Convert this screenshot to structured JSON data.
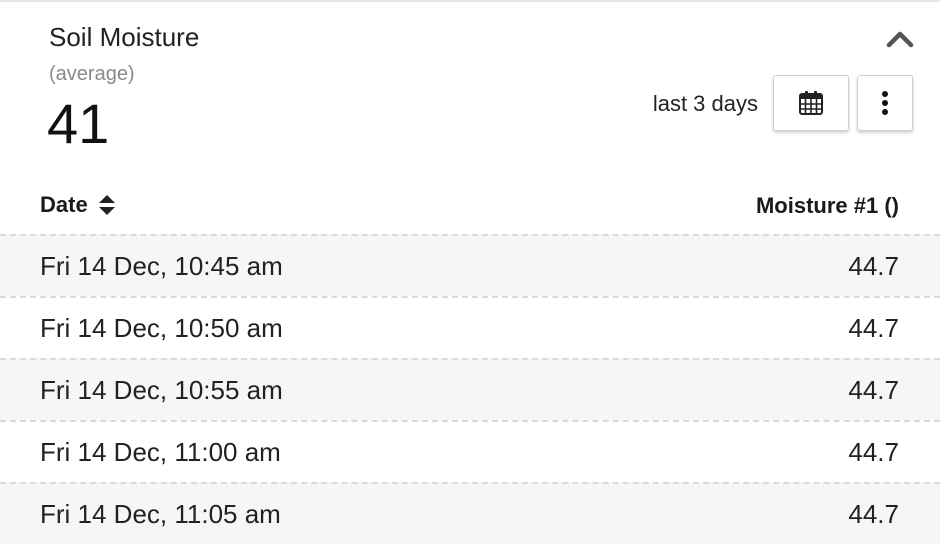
{
  "widget": {
    "title": "Soil Moisture",
    "subtitle": "(average)",
    "value": "41",
    "range_label": "last 3 days"
  },
  "icons": {
    "collapse": "chevron-up-icon",
    "calendar": "calendar-icon",
    "more": "more-vertical-icon",
    "sort": "sort-icon"
  },
  "table": {
    "columns": [
      "Date",
      "Moisture #1 ()"
    ],
    "rows": [
      {
        "date": "Fri 14 Dec, 10:45 am",
        "value": "44.7"
      },
      {
        "date": "Fri 14 Dec, 10:50 am",
        "value": "44.7"
      },
      {
        "date": "Fri 14 Dec, 10:55 am",
        "value": "44.7"
      },
      {
        "date": "Fri 14 Dec, 11:00 am",
        "value": "44.7"
      },
      {
        "date": "Fri 14 Dec, 11:05 am",
        "value": "44.7"
      }
    ]
  }
}
